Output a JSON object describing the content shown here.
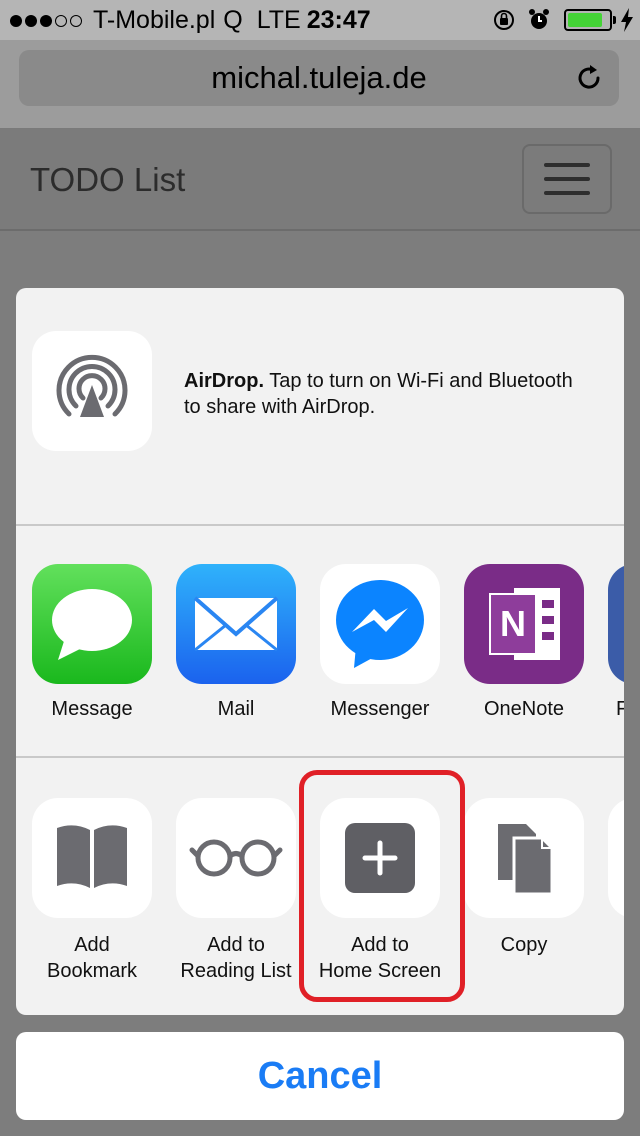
{
  "status_bar": {
    "carrier": "T-Mobile.pl",
    "carrier_extra": "Q",
    "network": "LTE",
    "time": "23:47",
    "battery_level": 0.9
  },
  "browser": {
    "url": "michal.tuleja.de"
  },
  "page": {
    "brand": "TODO List"
  },
  "share_sheet": {
    "airdrop": {
      "title": "AirDrop.",
      "text": "Tap to turn on Wi-Fi and Bluetooth to share with AirDrop."
    },
    "apps": [
      {
        "label": "Message",
        "icon": "message-icon"
      },
      {
        "label": "Mail",
        "icon": "mail-icon"
      },
      {
        "label": "Messenger",
        "icon": "messenger-icon"
      },
      {
        "label": "OneNote",
        "icon": "onenote-icon"
      },
      {
        "label": "F",
        "icon": "partial-app-icon"
      }
    ],
    "actions": [
      {
        "label_line1": "Add",
        "label_line2": "Bookmark",
        "icon": "bookmark-icon"
      },
      {
        "label_line1": "Add to",
        "label_line2": "Reading List",
        "icon": "reading-list-icon"
      },
      {
        "label_line1": "Add to",
        "label_line2": "Home Screen",
        "icon": "add-home-screen-icon"
      },
      {
        "label_line1": "Copy",
        "label_line2": "",
        "icon": "copy-icon"
      }
    ],
    "cancel_label": "Cancel"
  },
  "colors": {
    "accent": "#1a7cf5",
    "highlight": "#e02027",
    "battery": "#44d336"
  }
}
